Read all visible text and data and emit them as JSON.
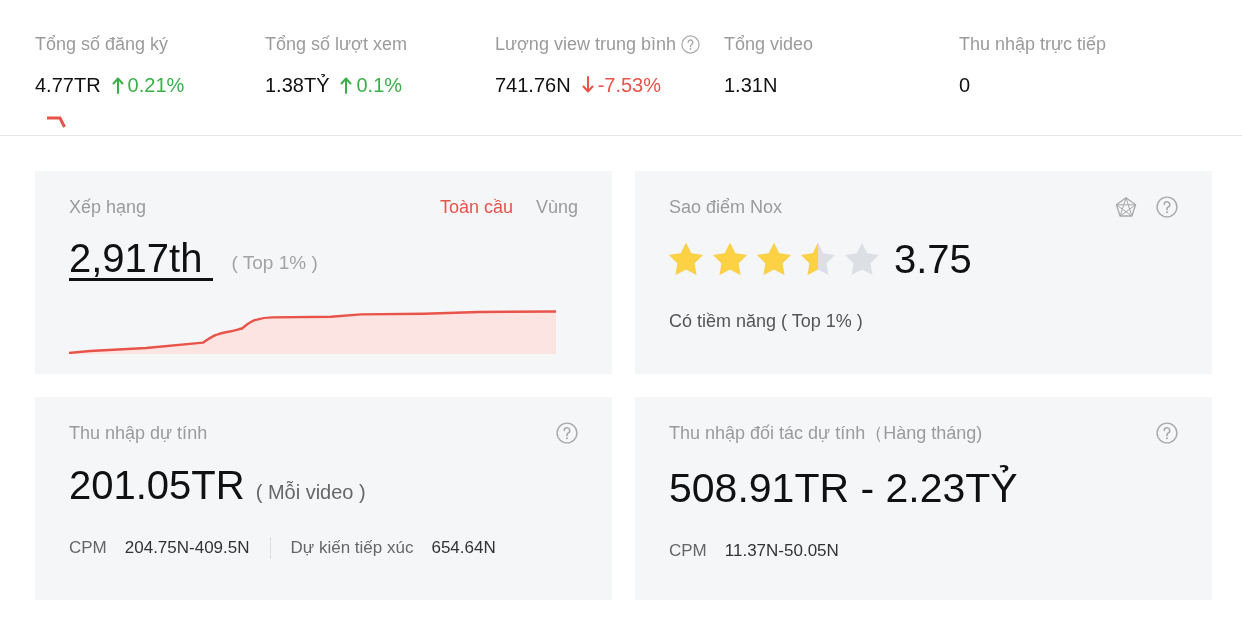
{
  "stats": [
    {
      "label": "Tổng số đăng ký",
      "help": false,
      "value": "4.77TR",
      "kind": "up",
      "change": "0.21%"
    },
    {
      "label": "Tổng số lượt xem",
      "help": false,
      "value": "1.38TỶ",
      "kind": "up",
      "change": "0.1%"
    },
    {
      "label": "Lượng view trung bình",
      "help": true,
      "value": "741.76N",
      "kind": "down",
      "change": "-7.53%"
    },
    {
      "label": "Tổng video",
      "help": false,
      "value": "1.31N"
    },
    {
      "label": "Thu nhập trực tiếp",
      "help": false,
      "value": "0"
    }
  ],
  "ranking": {
    "title": "Xếp hạng",
    "tabs": [
      {
        "label": "Toàn cầu",
        "selected": true
      },
      {
        "label": "Vùng",
        "selected": false
      }
    ],
    "rank": "2,917th",
    "percentile": "( Top 1% )"
  },
  "nox_score": {
    "title": "Sao điểm Nox",
    "stars": 3.5,
    "score": "3.75",
    "rating": "Có tiềm năng ( Top 1% )"
  },
  "estimated_income": {
    "title": "Thu nhập dự tính",
    "value": "201.05TR",
    "basis": "( Mỗi video )",
    "metrics": [
      {
        "label": "CPM",
        "value": "204.75N-409.5N"
      },
      {
        "label": "Dự kiến tiếp xúc",
        "value": "654.64N"
      }
    ]
  },
  "partner_income": {
    "title": "Thu nhập đối tác dự tính（Hàng tháng)",
    "value": "508.91TR - 2.23TỶ",
    "metrics": [
      {
        "label": "CPM",
        "value": "11.37N-50.05N"
      }
    ]
  }
}
